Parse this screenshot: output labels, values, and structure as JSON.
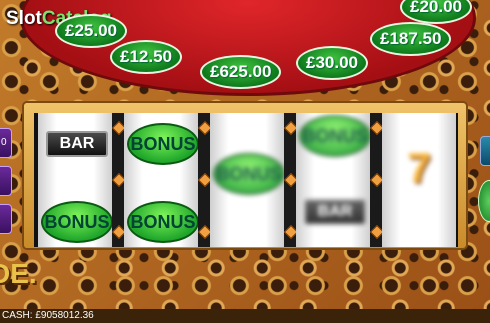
{
  "watermark": {
    "brand_left": "Slot",
    "brand_right": "Catalog"
  },
  "prizes": [
    "£25.00",
    "£20.00",
    "£187.50",
    "£12.50",
    "£625.00",
    "£30.00"
  ],
  "reels": [
    {
      "symbols": [
        "BAR",
        "BONUS"
      ]
    },
    {
      "symbols": [
        "BONUS",
        "BONUS"
      ]
    },
    {
      "symbols": [
        "BONUS"
      ]
    },
    {
      "symbols": [
        "BONUS",
        "BAR"
      ]
    },
    {
      "symbols": [
        "7"
      ]
    }
  ],
  "left_button_label": "0",
  "game_logo_text": "DE.",
  "cash": {
    "label": "CASH:",
    "value": "£9058012.36"
  }
}
